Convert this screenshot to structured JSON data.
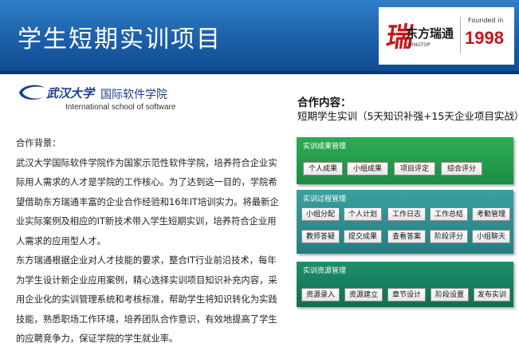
{
  "header": {
    "title": "学生短期实训项目",
    "brand_name": "东方瑞通",
    "brand_sub": "WINGTOP",
    "brand_mark": "瑞",
    "founded_label": "Founded in",
    "founded_year": "1998"
  },
  "school": {
    "name_cn_1": "武汉大学",
    "name_cn_2": "国际软件学院",
    "name_en": "International school of software"
  },
  "left": {
    "heading": "合作背景：",
    "paragraphs": [
      "武汉大学国际软件学院作为国家示范性软件学院，培养符合企业实际用人需求的人才是学院的工作核心。为了达到这一目的，学院希望借助东方瑞通丰富的企业合作经验和16年IT培训实力。将最新企业实际案例及相应的IT新技术带入学生短期实训，培养符合企业用人需求的应用型人才。",
      "东方瑞通根据企业对人才技能的要求，整合IT行业前沿技术，每年为学生设计新企业应用案例，精心选择实训项目知识补充内容，采用企业化的实训管理系统和考核标准，帮助学生将知识转化为实践技能，熟悉职场工作环境，培养团队合作意识，有效地提高了学生的应聘竞争力，保证学院的学生就业率。"
    ]
  },
  "right": {
    "coop_title": "合作内容：",
    "coop_desc": "短期学生实训（5天知识补强+15天企业项目实战）"
  },
  "panels": {
    "results": {
      "title": "实训成果管理",
      "buttons": [
        "个人成果",
        "小组成果",
        "项目评定",
        "综合评分"
      ]
    },
    "process": {
      "title": "实训过程管理",
      "row1": [
        "小组分配",
        "个人计划",
        "工作日志",
        "工作总结",
        "考勤管理"
      ],
      "row2": [
        "教师答疑",
        "提交成果",
        "查看答案",
        "阶段评分",
        "小组聊天"
      ]
    },
    "resources": {
      "title": "实训资源管理",
      "buttons": [
        "资源录入",
        "资源建立",
        "章节设计",
        "阶段设置",
        "发布实训"
      ]
    }
  },
  "colors": {
    "header_blue": "#1b5ea8",
    "brand_red": "#c8161d",
    "panel_green": "#1d8d42",
    "panel_teal": "#237e80",
    "panel_dark": "#0f6e52"
  }
}
